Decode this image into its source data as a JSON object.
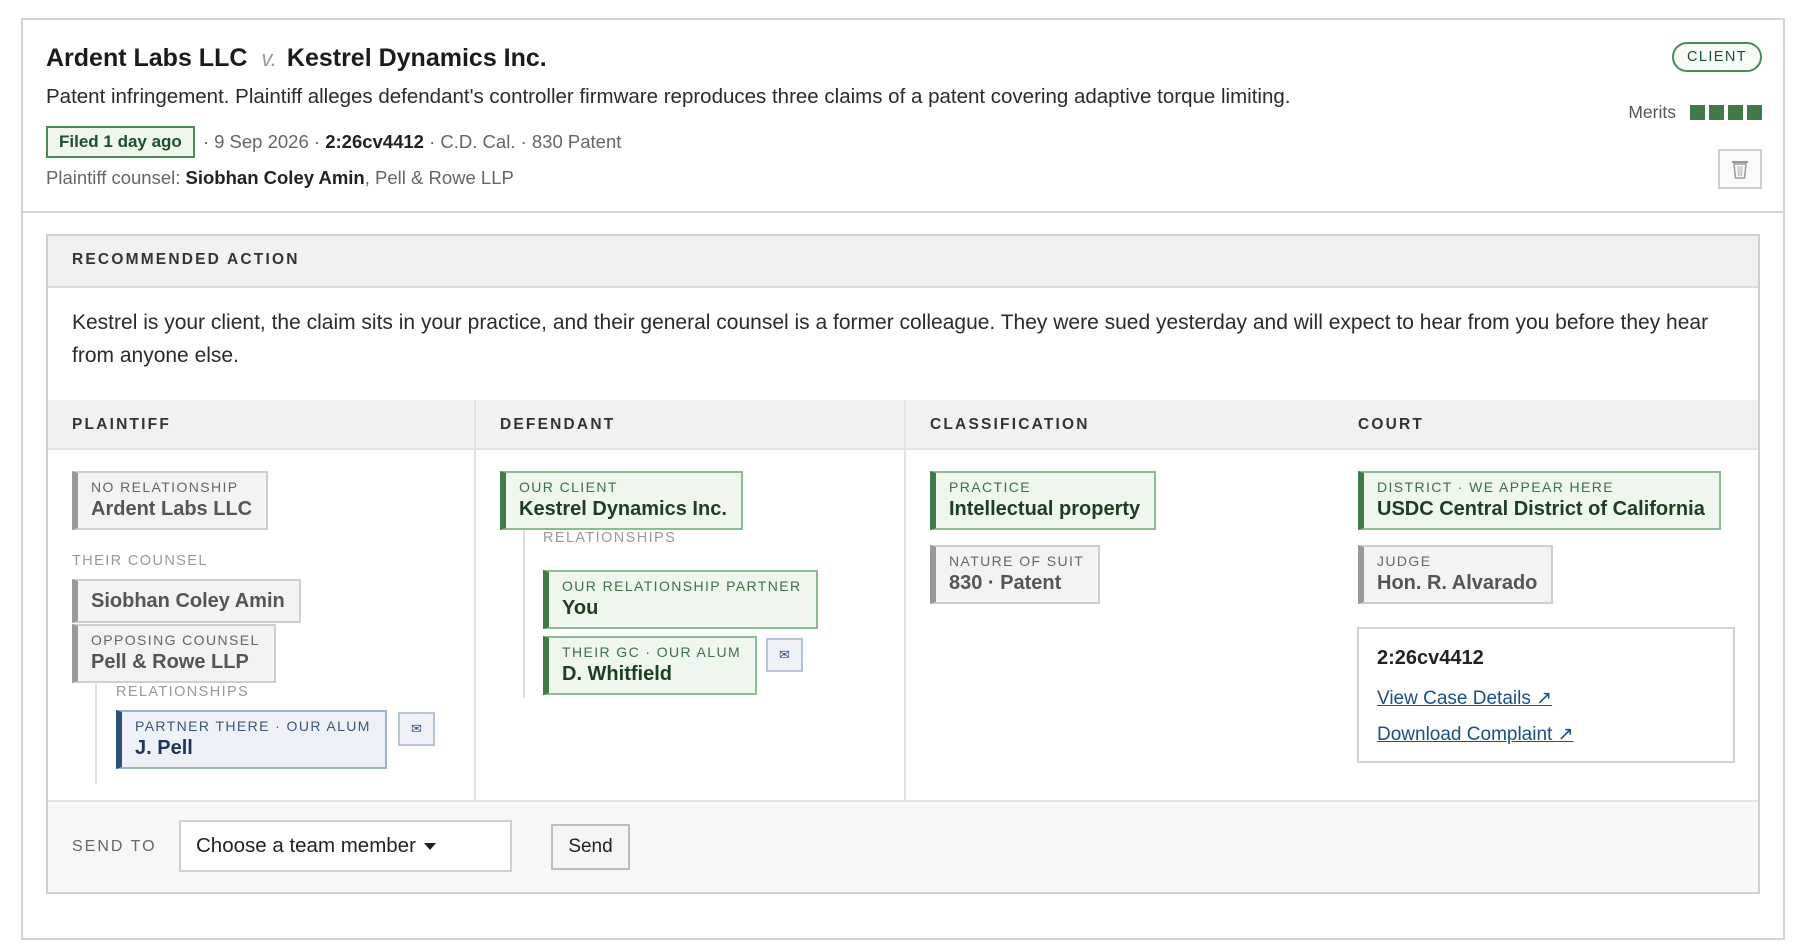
{
  "case": {
    "plaintiff": "Ardent Labs LLC",
    "vs": "v.",
    "defendant": "Kestrel Dynamics Inc.",
    "description": "Patent infringement. Plaintiff alleges defendant's controller firmware reproduces three claims of a patent covering adaptive torque limiting.",
    "filed_badge": "Filed 1 day ago",
    "date_text": "· 9 Sep 2026 ·",
    "case_number": "2:26cv4412",
    "court_text": "· C.D. Cal. · 830 Patent",
    "counsel_label": "Plaintiff counsel:",
    "counsel_name": "Siobhan Coley Amin",
    "counsel_firm": ", Pell & Rowe LLP",
    "client_badge": "CLIENT",
    "merits_label": "Merits",
    "merits_level": 4,
    "merits_max": 4,
    "merits_color": "#3f7a48"
  },
  "recommended": {
    "header": "RECOMMENDED ACTION",
    "text": "Kestrel is your client, the claim sits in your practice, and their general counsel is a former colleague. They were sued yesterday and will expect to hear from you before they hear from anyone else."
  },
  "columns": {
    "plaintiff": {
      "header": "PLAINTIFF",
      "party_kicker": "NO RELATIONSHIP",
      "party_name": "Ardent Labs LLC",
      "their_counsel_label": "THEIR COUNSEL",
      "counsel_name": "Siobhan Coley Amin",
      "firm_kicker": "OPPOSING COUNSEL",
      "firm_name": "Pell & Rowe LLP",
      "relationships_label": "RELATIONSHIPS",
      "rel_kicker": "PARTNER THERE · OUR ALUM",
      "rel_name": "J. Pell",
      "mail_icon": "✉"
    },
    "defendant": {
      "header": "DEFENDANT",
      "party_kicker": "OUR CLIENT",
      "party_name": "Kestrel Dynamics Inc.",
      "relationships_label": "RELATIONSHIPS",
      "rel1_kicker": "OUR RELATIONSHIP PARTNER",
      "rel1_name": "You",
      "rel2_kicker": "THEIR GC · OUR ALUM",
      "rel2_name": "D. Whitfield",
      "mail_icon": "✉"
    },
    "classification": {
      "header": "CLASSIFICATION",
      "practice_kicker": "PRACTICE",
      "practice_name": "Intellectual property",
      "nos_kicker": "NATURE OF SUIT",
      "nos_name": "830 · Patent"
    },
    "court": {
      "header": "COURT",
      "district_kicker": "DISTRICT · WE APPEAR HERE",
      "district_name": "USDC Central District of California",
      "judge_kicker": "JUDGE",
      "judge_name": "Hon. R. Alvarado",
      "case_number": "2:26cv4412",
      "link_details": "View Case Details ↗",
      "link_complaint": "Download Complaint ↗"
    }
  },
  "send": {
    "label": "SEND TO",
    "select_value": "Choose a team member",
    "button": "Send"
  },
  "colors": {
    "green": "#3f7a48",
    "blue": "#2d4f7c",
    "link": "#1c4f86"
  }
}
